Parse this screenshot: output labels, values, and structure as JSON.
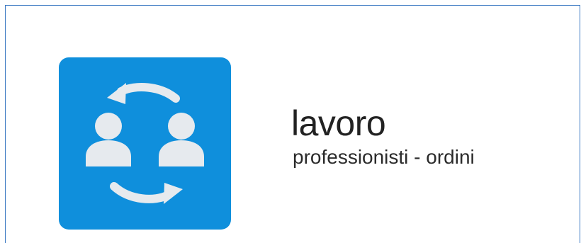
{
  "tile": {
    "icon": "people-exchange-icon",
    "background_color": "#0f8fdc",
    "icon_color": "#e6eaee"
  },
  "heading": {
    "title": "lavoro",
    "subtitle": "professionisti - ordini"
  },
  "frame_color": "#3a78c2"
}
